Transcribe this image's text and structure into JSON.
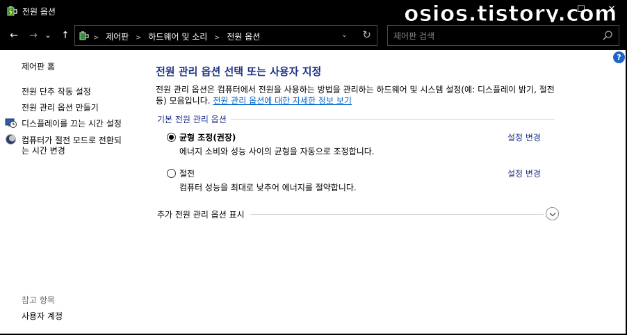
{
  "window": {
    "title": "전원 옵션",
    "watermark": "osios.tistory.com",
    "controls": {
      "minimize": "—",
      "maximize": "☐",
      "close": "✕"
    }
  },
  "nav": {
    "back": "←",
    "forward": "→",
    "recent": "⌄",
    "up": "↑",
    "breadcrumbs": [
      "제어판",
      "하드웨어 및 소리",
      "전원 옵션"
    ],
    "dropdown": "⌄",
    "refresh": "↻",
    "search_placeholder": "제어판 검색"
  },
  "sidebar": {
    "home": "제어판 홈",
    "links": [
      {
        "label": "전원 단추 작동 설정",
        "icon": null
      },
      {
        "label": "전원 관리 옵션 만들기",
        "icon": null
      },
      {
        "label": "디스플레이를 끄는 시간 설정",
        "icon": "display-clock-icon"
      },
      {
        "label_line1": "컴퓨터가 절전 모드로 전환되",
        "label_line2": "는 시간 변경",
        "icon": "moon-icon"
      }
    ],
    "see_also_heading": "참고 항목",
    "see_also": [
      "사용자 계정"
    ]
  },
  "main": {
    "title": "전원 관리 옵션 선택 또는 사용자 지정",
    "description": "전원 관리 옵션은 컴퓨터에서 전원을 사용하는 방법을 관리하는 하드웨어 및 시스템 설정(예: 디스플레이 밝기, 절전 등) 모음입니다. ",
    "description_link": "전원 관리 옵션에 대한 자세한 정보 보기",
    "group_label": "기본 전원 관리 옵션",
    "plans": [
      {
        "name": "균형 조정(권장)",
        "description": "에너지 소비와 성능 사이의 균형을 자동으로 조정합니다.",
        "selected": true,
        "change_label": "설정 변경"
      },
      {
        "name": "절전",
        "description": "컴퓨터 성능을 최대로 낮추어 에너지를 절약합니다.",
        "selected": false,
        "change_label": "설정 변경"
      }
    ],
    "more_label": "추가 전원 관리 옵션 표시",
    "help": "?"
  },
  "colors": {
    "title_blue": "#1e3287",
    "link_blue": "#0066cc",
    "chrome_bg": "#000000",
    "help_blue": "#1e64c8"
  }
}
